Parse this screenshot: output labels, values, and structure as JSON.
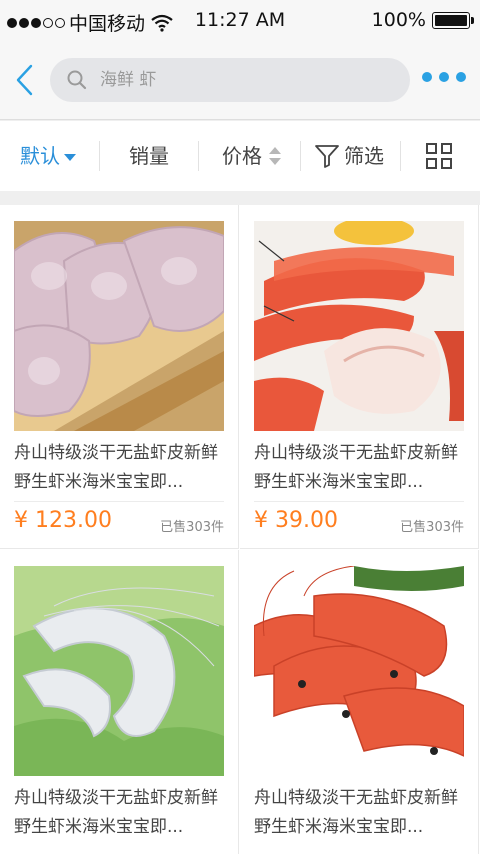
{
  "status_bar": {
    "carrier": "中国移动",
    "time": "11:27 AM",
    "battery": "100%",
    "signal_bars_filled": 3,
    "signal_bars_total": 5
  },
  "nav": {
    "back_icon": "chevron-left-icon",
    "search_placeholder": "海鲜 虾",
    "more_icon": "more-dots-icon",
    "accent_color": "#2aa1e3"
  },
  "filter": {
    "default_label": "默认",
    "sales_label": "销量",
    "price_label": "价格",
    "filter_label": "筛选",
    "layout_icon": "grid-view-icon"
  },
  "products": [
    {
      "title": "舟山特级淡干无盐虾皮新鲜野生虾米海米宝宝即...",
      "price": "¥ 123.00",
      "sold": "已售303件"
    },
    {
      "title": "舟山特级淡干无盐虾皮新鲜野生虾米海米宝宝即...",
      "price": "¥ 39.00",
      "sold": "已售303件"
    },
    {
      "title": "舟山特级淡干无盐虾皮新鲜野生虾米海米宝宝即...",
      "price": "",
      "sold": ""
    },
    {
      "title": "舟山特级淡干无盐虾皮新鲜野生虾米海米宝宝即...",
      "price": "",
      "sold": ""
    }
  ]
}
